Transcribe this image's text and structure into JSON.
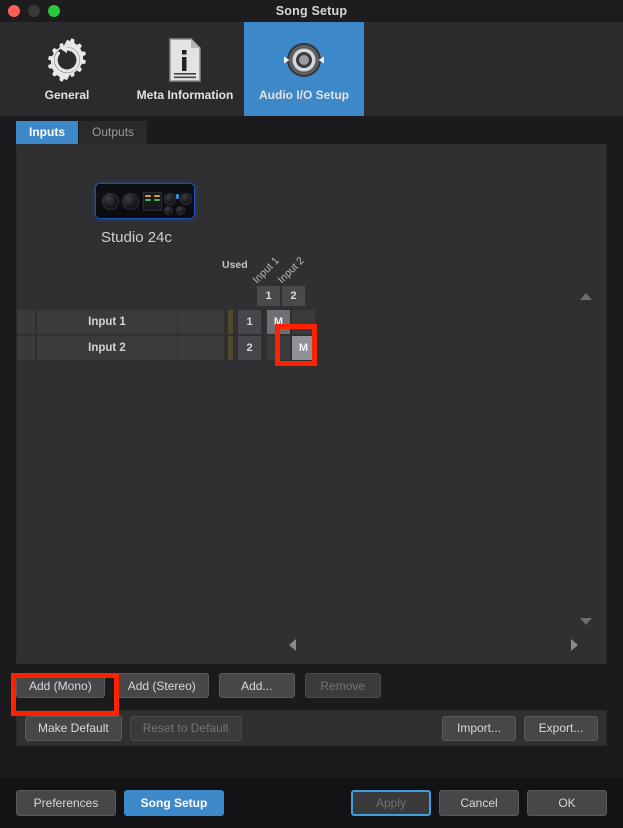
{
  "window": {
    "title": "Song Setup"
  },
  "toolbar": {
    "items": [
      {
        "label": "General",
        "icon": "gear-icon",
        "active": false
      },
      {
        "label": "Meta Information",
        "icon": "document-info-icon",
        "active": false
      },
      {
        "label": "Audio I/O Setup",
        "icon": "audio-io-icon",
        "active": true
      }
    ]
  },
  "tabs": [
    {
      "label": "Inputs",
      "active": true
    },
    {
      "label": "Outputs",
      "active": false
    }
  ],
  "device": {
    "name": "Studio 24c"
  },
  "matrix": {
    "used_header": "Used",
    "column_headers": [
      {
        "label": "Input 1",
        "number": "1"
      },
      {
        "label": "Input 2",
        "number": "2"
      }
    ],
    "rows": [
      {
        "name": "Input 1",
        "number": "1",
        "cells": [
          "M",
          ""
        ]
      },
      {
        "name": "Input 2",
        "number": "2",
        "cells": [
          "",
          "M"
        ]
      }
    ]
  },
  "add_buttons": [
    {
      "label": "Add (Mono)",
      "disabled": false,
      "highlighted": true
    },
    {
      "label": "Add (Stereo)",
      "disabled": false,
      "highlighted": false
    },
    {
      "label": "Add...",
      "disabled": false,
      "highlighted": false
    },
    {
      "label": "Remove",
      "disabled": true,
      "highlighted": false
    }
  ],
  "defaults_bar": {
    "make_default": "Make Default",
    "reset_to_default": "Reset to Default",
    "import": "Import...",
    "export": "Export..."
  },
  "footer": {
    "preferences": "Preferences",
    "song_setup": "Song Setup",
    "apply": "Apply",
    "cancel": "Cancel",
    "ok": "OK"
  },
  "colors": {
    "accent": "#3d88c8",
    "highlight": "#ff2200",
    "panel": "#303032",
    "background": "#1b1b1d"
  }
}
